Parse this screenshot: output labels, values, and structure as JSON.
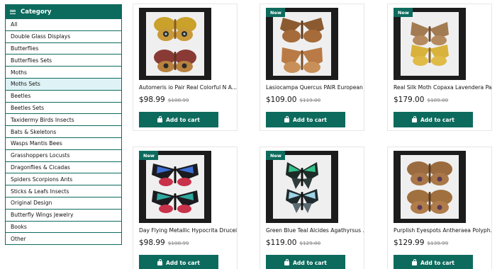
{
  "sidebar": {
    "header": "Category",
    "items": [
      "All",
      "Double Glass Displays",
      "Butterflies",
      "Butterflies Sets",
      "Moths",
      "Moths Sets",
      "Beetles",
      "Beetles Sets",
      "Taxidermy Birds Insects",
      "Bats & Skeletons",
      "Wasps Mantis Bees",
      "Grasshoppers Locusts",
      "Dragonflies & Cicadas",
      "Spiders Scorpions Ants",
      "Sticks & Leafs Insects",
      "Original Design",
      "Butterfly Wings Jewelry",
      "Books",
      "Other"
    ],
    "active_item": "Moths Sets"
  },
  "products": [
    {
      "title": "Automeris io Pair Real Colorful N A...",
      "price": "$98.99",
      "old_price": "$108.99",
      "badge": "",
      "button": "Add to cart"
    },
    {
      "title": "Lasiocampa Quercus PAIR European ...",
      "price": "$109.00",
      "old_price": "$119.00",
      "badge": "New",
      "button": "Add to cart"
    },
    {
      "title": "Real Silk Moth Copaxa Lavendera Pa...",
      "price": "$179.00",
      "old_price": "$189.00",
      "badge": "New",
      "button": "Add to cart"
    },
    {
      "title": "Day Flying Metallic Hypocrita Drucei...",
      "price": "$98.99",
      "old_price": "$108.99",
      "badge": "New",
      "button": "Add to cart"
    },
    {
      "title": "Green Blue Teal Alcides Agathyrsus ...",
      "price": "$119.00",
      "old_price": "$129.00",
      "badge": "New",
      "button": "Add to cart"
    },
    {
      "title": "Purplish Eyespots Antheraea Polyph...",
      "price": "$129.99",
      "old_price": "$139.99",
      "badge": "",
      "button": "Add to cart"
    }
  ],
  "icons": {
    "category_header": "menu-icon",
    "cart_button": "shopping-bag-icon"
  },
  "colors": {
    "accent": "#0d6b5e",
    "active_category_bg": "#dff3f6"
  }
}
